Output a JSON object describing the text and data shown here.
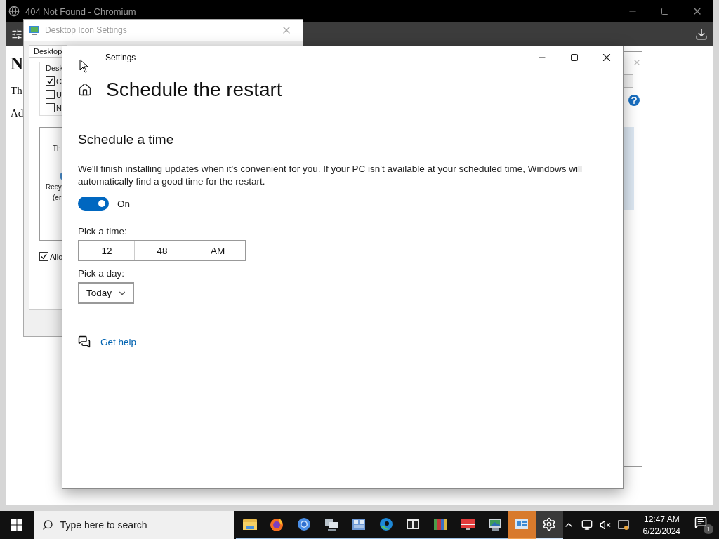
{
  "browser": {
    "title": "404 Not Found - Chromium",
    "page_texts": [
      "N",
      "Th",
      "Ad"
    ]
  },
  "desktop_icon_settings": {
    "title": "Desktop Icon Settings",
    "tab": "Desktop",
    "group_label": "Desk",
    "checkboxes": [
      {
        "label": "C",
        "checked": true
      },
      {
        "label": "U",
        "checked": false
      },
      {
        "label": "N",
        "checked": false
      }
    ],
    "preview_labels": [
      "Th",
      "Recy",
      "(er"
    ],
    "allow_checkbox": {
      "label": "Allo",
      "checked": true
    }
  },
  "settings": {
    "title": "Settings",
    "heading": "Schedule the restart",
    "section": "Schedule a time",
    "description": "We'll finish installing updates when it's convenient for you. If your PC isn't available at your scheduled time, Windows will automatically find a good time for the restart.",
    "toggle": {
      "on": true,
      "label": "On"
    },
    "time_label": "Pick a time:",
    "time_parts": [
      "12",
      "48",
      "AM"
    ],
    "day_label": "Pick a day:",
    "day_value": "Today",
    "help_link": "Get help"
  },
  "taskbar": {
    "search_placeholder": "Type here to search",
    "apps": [
      {
        "kind": "folder",
        "running": true,
        "flashing": false,
        "selected": false
      },
      {
        "kind": "firefox",
        "running": true,
        "flashing": false,
        "selected": false
      },
      {
        "kind": "chromium",
        "running": true,
        "flashing": false,
        "selected": false
      },
      {
        "kind": "network",
        "running": true,
        "flashing": false,
        "selected": false
      },
      {
        "kind": "control-panel",
        "running": true,
        "flashing": false,
        "selected": false
      },
      {
        "kind": "edge",
        "running": true,
        "flashing": false,
        "selected": false
      },
      {
        "kind": "archive",
        "running": true,
        "flashing": false,
        "selected": false
      },
      {
        "kind": "books",
        "running": true,
        "flashing": false,
        "selected": false
      },
      {
        "kind": "red-monitor",
        "running": true,
        "flashing": false,
        "selected": false
      },
      {
        "kind": "picture-monitor",
        "running": true,
        "flashing": false,
        "selected": false
      },
      {
        "kind": "desktop-card",
        "running": true,
        "flashing": true,
        "selected": false
      },
      {
        "kind": "gear",
        "running": true,
        "flashing": false,
        "selected": true
      }
    ],
    "clock_time": "12:47 AM",
    "clock_date": "6/22/2024",
    "notification_count": "1"
  }
}
